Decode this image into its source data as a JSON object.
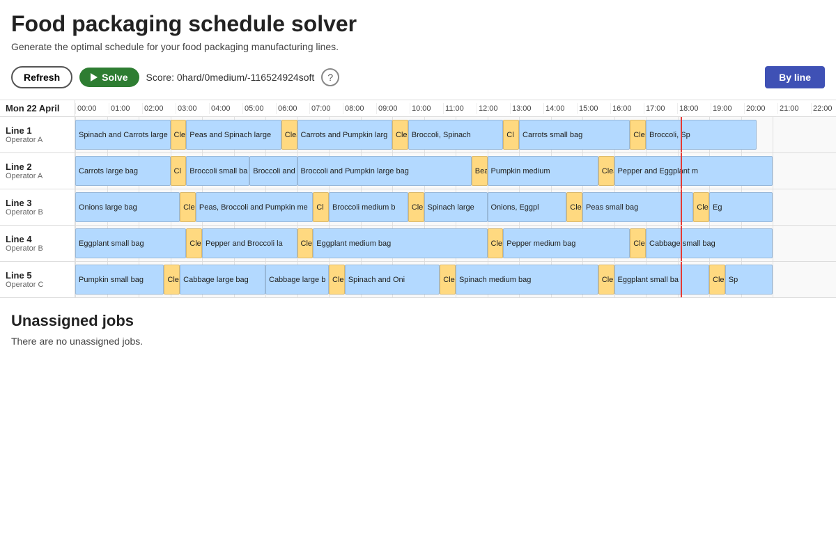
{
  "page": {
    "title": "Food packaging schedule solver",
    "subtitle": "Generate the optimal schedule for your food packaging manufacturing lines.",
    "toolbar": {
      "refresh_label": "Refresh",
      "solve_label": "Solve",
      "score_label": "Score: 0hard/0medium/-116524924soft",
      "help_label": "?",
      "by_line_label": "By line"
    },
    "schedule": {
      "date_label": "Mon 22 April",
      "hours": [
        "00:00",
        "01:00",
        "02:00",
        "03:00",
        "04:00",
        "05:00",
        "06:00",
        "07:00",
        "08:00",
        "09:00",
        "10:00",
        "11:00",
        "12:00",
        "13:00",
        "14:00",
        "15:00",
        "16:00",
        "17:00",
        "18:00",
        "19:00",
        "20:00",
        "21:00",
        "22:00"
      ],
      "total_hours": 24,
      "current_time_hour": 19.1,
      "lines": [
        {
          "name": "Line 1",
          "operator": "Operator A",
          "blocks": [
            {
              "label": "Spinach and Carrots large ba",
              "start": 0,
              "end": 3.0,
              "type": "job"
            },
            {
              "label": "Clea",
              "start": 3.0,
              "end": 3.5,
              "type": "clean"
            },
            {
              "label": "Peas and Spinach large",
              "start": 3.5,
              "end": 6.5,
              "type": "job"
            },
            {
              "label": "Clea",
              "start": 6.5,
              "end": 7.0,
              "type": "clean"
            },
            {
              "label": "Carrots and Pumpkin larg",
              "start": 7.0,
              "end": 10.0,
              "type": "job"
            },
            {
              "label": "Clea",
              "start": 10.0,
              "end": 10.5,
              "type": "clean"
            },
            {
              "label": "Broccoli, Spinach",
              "start": 10.5,
              "end": 13.5,
              "type": "job"
            },
            {
              "label": "Cl",
              "start": 13.5,
              "end": 14.0,
              "type": "clean"
            },
            {
              "label": "Carrots small bag",
              "start": 14.0,
              "end": 17.5,
              "type": "job"
            },
            {
              "label": "Clea",
              "start": 17.5,
              "end": 18.0,
              "type": "clean"
            },
            {
              "label": "Broccoli, Sp",
              "start": 18.0,
              "end": 21.5,
              "type": "job"
            }
          ]
        },
        {
          "name": "Line 2",
          "operator": "Operator A",
          "blocks": [
            {
              "label": "Carrots large bag",
              "start": 0,
              "end": 3.0,
              "type": "job"
            },
            {
              "label": "Cl",
              "start": 3.0,
              "end": 3.5,
              "type": "clean"
            },
            {
              "label": "Broccoli small ba",
              "start": 3.5,
              "end": 5.5,
              "type": "job"
            },
            {
              "label": "Broccoli and P",
              "start": 5.5,
              "end": 7.0,
              "type": "job"
            },
            {
              "label": "Broccoli and Pumpkin large bag",
              "start": 7.0,
              "end": 12.5,
              "type": "job"
            },
            {
              "label": "Bea",
              "start": 12.5,
              "end": 13.0,
              "type": "clean"
            },
            {
              "label": "Pumpkin medium",
              "start": 13.0,
              "end": 16.5,
              "type": "job"
            },
            {
              "label": "Clea",
              "start": 16.5,
              "end": 17.0,
              "type": "clean"
            },
            {
              "label": "Pepper and Eggplant m",
              "start": 17.0,
              "end": 22.0,
              "type": "job"
            }
          ]
        },
        {
          "name": "Line 3",
          "operator": "Operator B",
          "blocks": [
            {
              "label": "Onions large bag",
              "start": 0,
              "end": 3.3,
              "type": "job"
            },
            {
              "label": "Cle",
              "start": 3.3,
              "end": 3.8,
              "type": "clean"
            },
            {
              "label": "Peas, Broccoli and Pumpkin me",
              "start": 3.8,
              "end": 7.5,
              "type": "job"
            },
            {
              "label": "Cl",
              "start": 7.5,
              "end": 8.0,
              "type": "clean"
            },
            {
              "label": "Broccoli medium b",
              "start": 8.0,
              "end": 10.5,
              "type": "job"
            },
            {
              "label": "Cle",
              "start": 10.5,
              "end": 11.0,
              "type": "clean"
            },
            {
              "label": "Spinach large",
              "start": 11.0,
              "end": 13.0,
              "type": "job"
            },
            {
              "label": "Onions, Eggpl",
              "start": 13.0,
              "end": 15.5,
              "type": "job"
            },
            {
              "label": "Cle",
              "start": 15.5,
              "end": 16.0,
              "type": "clean"
            },
            {
              "label": "Peas small bag",
              "start": 16.0,
              "end": 19.5,
              "type": "job"
            },
            {
              "label": "Clea",
              "start": 19.5,
              "end": 20.0,
              "type": "clean"
            },
            {
              "label": "Eg",
              "start": 20.0,
              "end": 22.0,
              "type": "job"
            }
          ]
        },
        {
          "name": "Line 4",
          "operator": "Operator B",
          "blocks": [
            {
              "label": "Eggplant small bag",
              "start": 0,
              "end": 3.5,
              "type": "job"
            },
            {
              "label": "Cle",
              "start": 3.5,
              "end": 4.0,
              "type": "clean"
            },
            {
              "label": "Pepper and Broccoli la",
              "start": 4.0,
              "end": 7.0,
              "type": "job"
            },
            {
              "label": "Clea",
              "start": 7.0,
              "end": 7.5,
              "type": "clean"
            },
            {
              "label": "Eggplant medium bag",
              "start": 7.5,
              "end": 13.0,
              "type": "job"
            },
            {
              "label": "Clean",
              "start": 13.0,
              "end": 13.5,
              "type": "clean"
            },
            {
              "label": "Pepper medium bag",
              "start": 13.5,
              "end": 17.5,
              "type": "job"
            },
            {
              "label": "Clean",
              "start": 17.5,
              "end": 18.0,
              "type": "clean"
            },
            {
              "label": "Cabbage small bag",
              "start": 18.0,
              "end": 22.0,
              "type": "job"
            }
          ]
        },
        {
          "name": "Line 5",
          "operator": "Operator C",
          "blocks": [
            {
              "label": "Pumpkin small bag",
              "start": 0,
              "end": 2.8,
              "type": "job"
            },
            {
              "label": "Cle",
              "start": 2.8,
              "end": 3.3,
              "type": "clean"
            },
            {
              "label": "Cabbage large bag",
              "start": 3.3,
              "end": 6.0,
              "type": "job"
            },
            {
              "label": "Cabbage large b",
              "start": 6.0,
              "end": 8.0,
              "type": "job"
            },
            {
              "label": "Cle",
              "start": 8.0,
              "end": 8.5,
              "type": "clean"
            },
            {
              "label": "Spinach and Oni",
              "start": 8.5,
              "end": 11.5,
              "type": "job"
            },
            {
              "label": "Cle",
              "start": 11.5,
              "end": 12.0,
              "type": "clean"
            },
            {
              "label": "Spinach medium bag",
              "start": 12.0,
              "end": 16.5,
              "type": "job"
            },
            {
              "label": "Cle",
              "start": 16.5,
              "end": 17.0,
              "type": "clean"
            },
            {
              "label": "Eggplant small ba",
              "start": 17.0,
              "end": 20.0,
              "type": "job"
            },
            {
              "label": "Clea",
              "start": 20.0,
              "end": 20.5,
              "type": "clean"
            },
            {
              "label": "Sp",
              "start": 20.5,
              "end": 22.0,
              "type": "job"
            }
          ]
        }
      ]
    },
    "unassigned": {
      "title": "Unassigned jobs",
      "text": "There are no unassigned jobs."
    }
  }
}
